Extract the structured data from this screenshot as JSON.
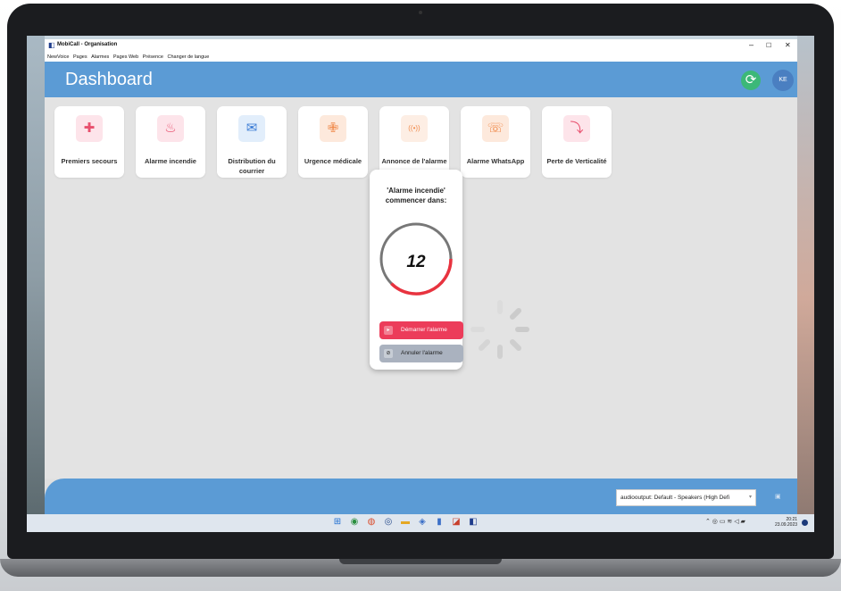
{
  "window": {
    "title": "MobiCall - Organisation",
    "controls": {
      "minimize": "–",
      "maximize": "☐",
      "close": "✕"
    }
  },
  "menu": [
    "NewVoice",
    "Pages",
    "Alarmes",
    "Pages Web",
    "Présence",
    "Changer de langue"
  ],
  "header": {
    "title": "Dashboard",
    "avatar_initials": "KE",
    "refresh_icon": "refresh-icon"
  },
  "tiles": [
    {
      "label": "Premiers secours",
      "icon": "first-aid-icon",
      "glyph": "✚",
      "bg": "#fde4ea",
      "fg": "#e8506e"
    },
    {
      "label": "Alarme incendie",
      "icon": "fire-icon",
      "glyph": "♨",
      "bg": "#fde4ea",
      "fg": "#e8506e"
    },
    {
      "label": "Distribution du courrier",
      "icon": "mail-icon",
      "glyph": "✉",
      "bg": "#e2eefb",
      "fg": "#3a7bd5"
    },
    {
      "label": "Urgence médicale",
      "icon": "medical-icon",
      "glyph": "✙",
      "bg": "#fde9dc",
      "fg": "#f08a4b"
    },
    {
      "label": "Annonce de l'alarme",
      "icon": "broadcast-icon",
      "glyph": "((•))",
      "bg": "#fdeee4",
      "fg": "#f08a4b"
    },
    {
      "label": "Alarme WhatsApp",
      "icon": "chat-icon",
      "glyph": "☏",
      "bg": "#fde9dc",
      "fg": "#f08a4b"
    },
    {
      "label": "Perte de Verticalité",
      "icon": "fall-icon",
      "glyph": "⤵",
      "bg": "#fde4ea",
      "fg": "#e8506e"
    }
  ],
  "modal": {
    "title_line1": "'Alarme incendie'",
    "title_line2": "commencer dans:",
    "countdown": "12",
    "start_label": "Démarrer l'alarme",
    "cancel_label": "Annuler l'alarme"
  },
  "footer": {
    "audio_output": "audiooutput: Default - Speakers (High Defi"
  },
  "taskbar": {
    "time": "20:21",
    "date": "23.09.2023"
  },
  "colors": {
    "header": "#5b9bd5",
    "start_button": "#ec3c5a",
    "cancel_button": "#aab2bf",
    "refresh": "#3cb878",
    "avatar": "#4a7fc1"
  }
}
